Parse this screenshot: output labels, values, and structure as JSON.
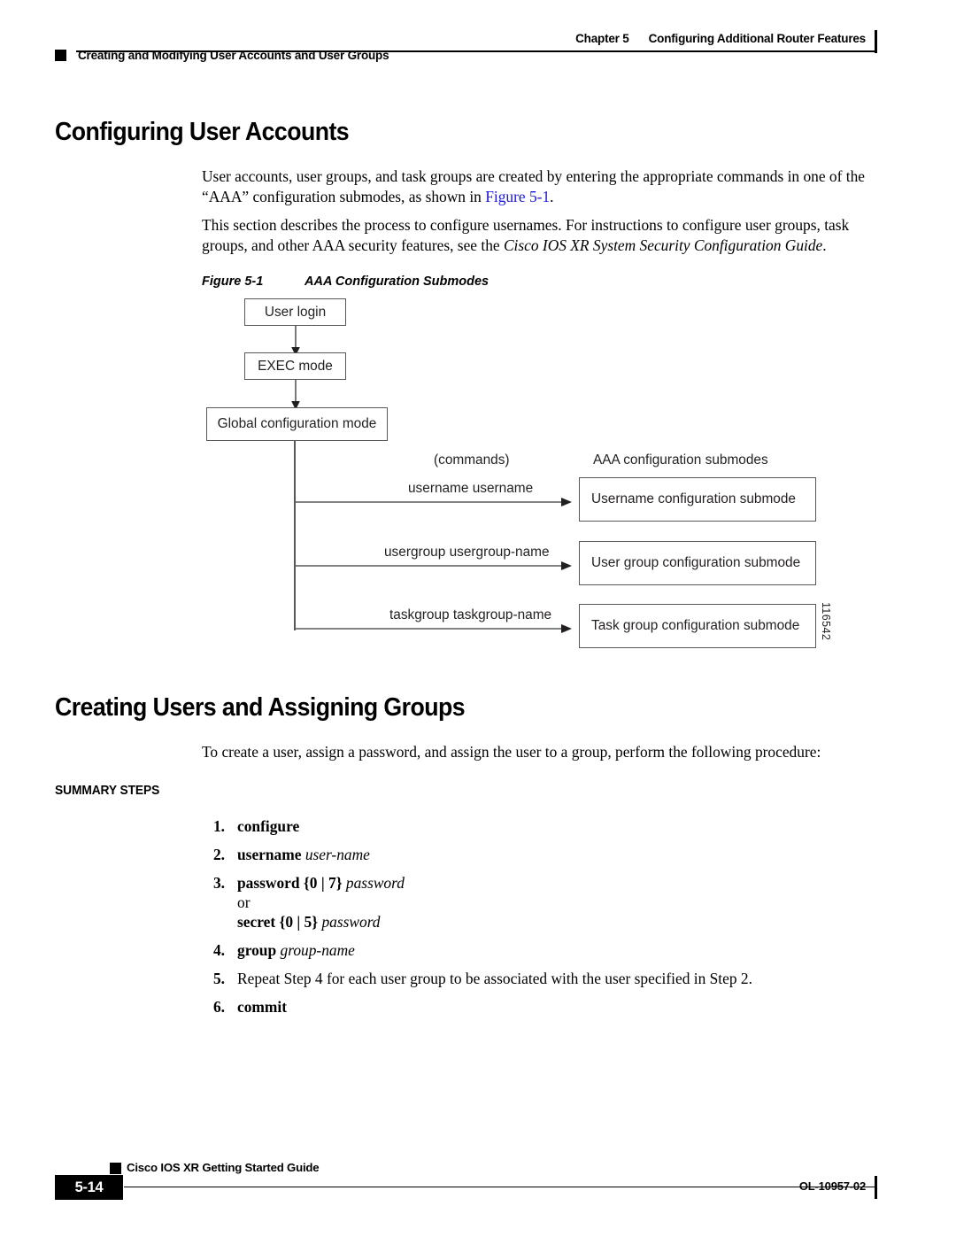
{
  "header": {
    "chapter_label": "Chapter 5",
    "chapter_title": "Configuring Additional Router Features",
    "running_head": "Creating and Modifying User Accounts and User Groups"
  },
  "sections": {
    "configuring_user_accounts": {
      "title": "Configuring User Accounts",
      "para_1_a": "User accounts, user groups, and task groups are created by entering the appropriate commands in one of the “AAA” configuration submodes, as shown in ",
      "para_1_link": "Figure 5-1",
      "para_1_b": ".",
      "para_2_a": "This section describes the process to configure usernames. For instructions to configure user groups, task groups, and other AAA security features, see the ",
      "para_2_italic": "Cisco IOS XR System Security Configuration Guide",
      "para_2_b": "."
    },
    "creating_users": {
      "title": "Creating Users and Assigning Groups",
      "intro": "To create a user, assign a password, and assign the user to a group, perform the following procedure:",
      "summary_steps_label": "SUMMARY STEPS"
    }
  },
  "figure": {
    "caption_number": "Figure 5-1",
    "caption_title": "AAA Configuration Submodes",
    "art_id": "116542",
    "nodes": {
      "user_login": "User login",
      "exec_mode": "EXEC mode",
      "global_config": "Global configuration mode"
    },
    "column_headers": {
      "commands": "(commands)",
      "submodes": "AAA configuration submodes"
    },
    "branches": [
      {
        "command": "username username",
        "target": "Username configuration submode"
      },
      {
        "command": "usergroup usergroup-name",
        "target": "User group configuration submode"
      },
      {
        "command": "taskgroup taskgroup-name",
        "target": "Task group configuration submode"
      }
    ]
  },
  "steps": [
    {
      "num": "1.",
      "cmd": "configure",
      "arg": ""
    },
    {
      "num": "2.",
      "cmd": "username",
      "arg": "user-name"
    },
    {
      "num": "3.",
      "cmd": "password",
      "brace": "{0 | 7}",
      "arg": "password",
      "or": "or",
      "alt_cmd": "secret",
      "alt_brace": "{0 | 5}",
      "alt_arg": "password"
    },
    {
      "num": "4.",
      "cmd": "group",
      "arg": "group-name"
    },
    {
      "num": "5.",
      "text": "Repeat Step 4 for each user group to be associated with the user specified in Step 2."
    },
    {
      "num": "6.",
      "cmd": "commit",
      "arg": ""
    }
  ],
  "footer": {
    "guide_title": "Cisco IOS XR Getting Started Guide",
    "page_number": "5-14",
    "doc_id": "OL-10957-02"
  },
  "colors": {
    "link": "#1a15d8",
    "diagram_stroke": "#58585a",
    "text": "#000000"
  }
}
